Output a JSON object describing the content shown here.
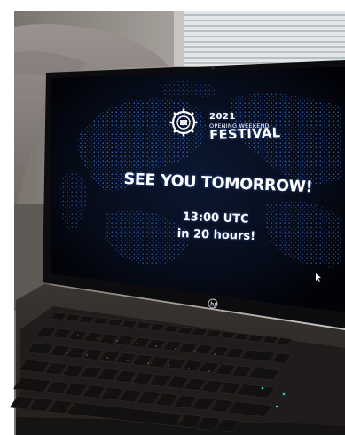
{
  "screen": {
    "logo": {
      "year": "2021",
      "subtitle": "OPENING WEEKEND",
      "title": "FESTIVAL",
      "icon": "igem-gear-logo"
    },
    "headline": "SEE YOU TOMORROW!",
    "time": "13:00 UTC",
    "countdown": "in 20 hours!"
  },
  "laptop": {
    "brand_logo": "hp-logo"
  },
  "colors": {
    "screen_background": "#05070f",
    "globe_dots": "#3a6fe0",
    "text": "#ffffff",
    "laptop_body": "#2b2826",
    "keyboard_keys": "#1a1918",
    "couch": "#8e8784",
    "window_blinds": "#d9dde0"
  }
}
